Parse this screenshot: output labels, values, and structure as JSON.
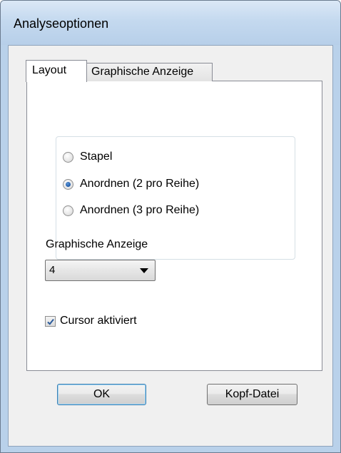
{
  "window": {
    "title": "Analyseoptionen"
  },
  "tabs": [
    {
      "label": "Layout",
      "selected": true
    },
    {
      "label": "Graphische Anzeige",
      "selected": false
    }
  ],
  "layout_options": [
    {
      "label": "Stapel",
      "checked": false
    },
    {
      "label": "Anordnen (2 pro Reihe)",
      "checked": true
    },
    {
      "label": "Anordnen (3 pro Reihe)",
      "checked": false
    }
  ],
  "graph_display": {
    "label": "Graphische Anzeige",
    "selected_value": "4"
  },
  "cursor": {
    "label": "Cursor aktiviert",
    "checked": true
  },
  "buttons": {
    "ok_label": "OK",
    "header_file_label": "Kopf-Datei"
  },
  "colors": {
    "title_bar": "#c4d9ef",
    "dialog_background": "#f0f0f0",
    "radio_selected": "#1e5aa8",
    "default_button_border": "#3c7fb1"
  }
}
